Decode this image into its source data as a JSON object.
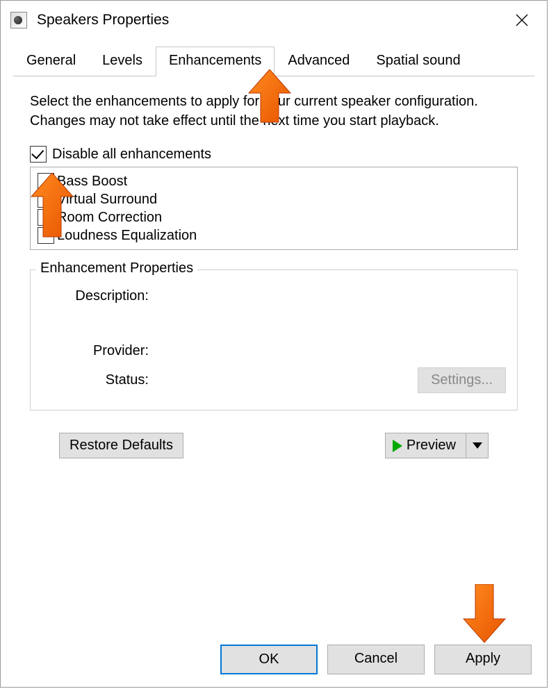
{
  "window": {
    "title": "Speakers Properties"
  },
  "tabs": {
    "items": [
      {
        "label": "General"
      },
      {
        "label": "Levels"
      },
      {
        "label": "Enhancements"
      },
      {
        "label": "Advanced"
      },
      {
        "label": "Spatial sound"
      }
    ],
    "active_index": 2
  },
  "content": {
    "description": "Select the enhancements to apply for your current speaker configuration. Changes may not take effect until the next time you start playback.",
    "disable_all_label": "Disable all enhancements",
    "disable_all_checked": true,
    "list": [
      {
        "label": "Bass Boost",
        "checked": false
      },
      {
        "label": "Virtual Surround",
        "checked": false
      },
      {
        "label": "Room Correction",
        "checked": false
      },
      {
        "label": "Loudness Equalization",
        "checked": false
      }
    ]
  },
  "group": {
    "legend": "Enhancement Properties",
    "desc_label": "Description:",
    "provider_label": "Provider:",
    "status_label": "Status:",
    "settings_button": "Settings..."
  },
  "buttons": {
    "restore": "Restore Defaults",
    "preview": "Preview",
    "ok": "OK",
    "cancel": "Cancel",
    "apply": "Apply"
  }
}
